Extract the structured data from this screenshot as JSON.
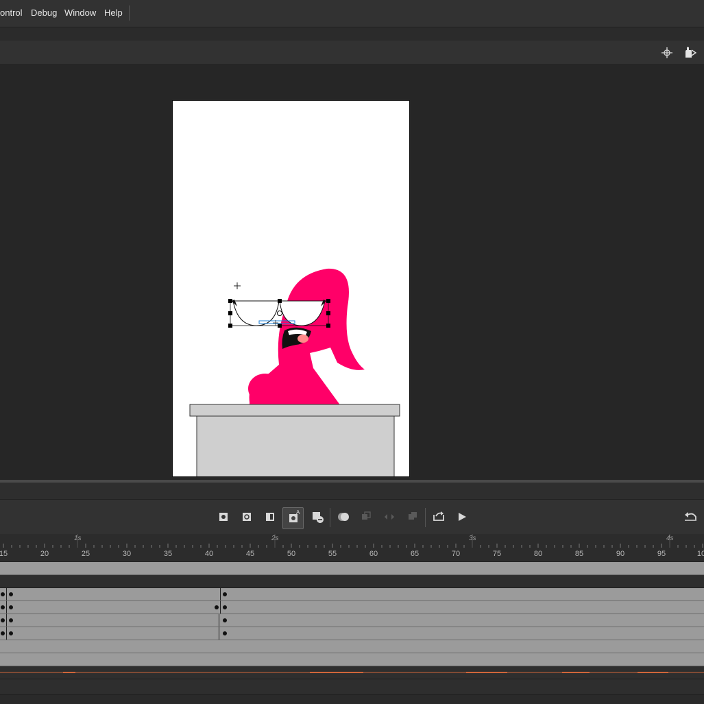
{
  "menu": {
    "items": [
      "ontrol",
      "Debug",
      "Window",
      "Help"
    ]
  },
  "toolbar": {
    "icons": [
      "center-stage-icon",
      "hand-rotate-icon"
    ]
  },
  "stage": {
    "background": "#ffffff",
    "character_color": "#ff0068",
    "desk_color": "#cfcfcf"
  },
  "timeline": {
    "controls": [
      "insert-keyframe-icon",
      "insert-blank-keyframe-icon",
      "insert-frame-icon",
      "auto-keyframe-icon",
      "clear-keyframe-icon",
      "onion-skin-icon",
      "onion-outline-icon",
      "edit-multiple-frames-icon",
      "onion-markers-icon",
      "loop-icon",
      "play-icon",
      "undo-icon"
    ],
    "seconds": [
      {
        "label": "1s"
      },
      {
        "label": "2s"
      },
      {
        "label": "3s"
      },
      {
        "label": "4s"
      }
    ],
    "frames": [
      "15",
      "20",
      "25",
      "30",
      "35",
      "40",
      "45",
      "50",
      "55",
      "60",
      "65",
      "70",
      "75",
      "80",
      "85",
      "90",
      "95",
      "10"
    ]
  }
}
